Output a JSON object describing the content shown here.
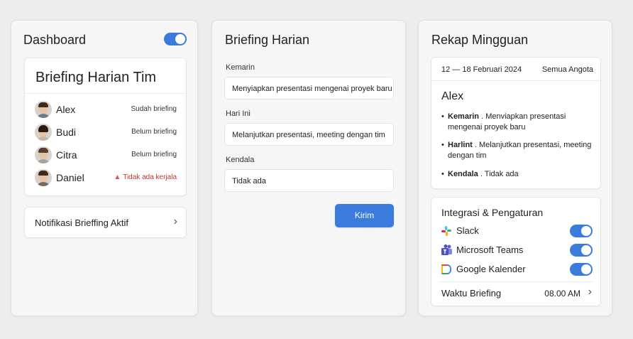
{
  "dashboard": {
    "title": "Dashboard",
    "toggle_on": true,
    "team_card_title": "Briefing Harian Tim",
    "members": [
      {
        "name": "Alex",
        "status": "Sudah briefing"
      },
      {
        "name": "Budi",
        "status": "Belum briefing"
      },
      {
        "name": "Citra",
        "status": "Belum briefing"
      },
      {
        "name": "Daniel",
        "status": "Tidak ada kerjala",
        "warning": true
      }
    ],
    "notification_label": "Notifikasi Brieffing Aktif"
  },
  "briefing": {
    "title": "Briefing Harian",
    "fields": [
      {
        "label": "Kemarin",
        "value": "Menyiapkan presentasi mengenai proyek baru"
      },
      {
        "label": "Hari Ini",
        "value": "Melanjutkan presentasi, meeting dengan tim"
      },
      {
        "label": "Kendala",
        "value": "Tidak ada"
      }
    ],
    "submit_label": "Kirim"
  },
  "recap": {
    "title": "Rekap Mingguan",
    "date_range": "12 — 18 Februari 2024",
    "scope": "Semua Angota",
    "person": "Alex",
    "items": [
      {
        "key": "Kemarin",
        "text": ". Menviapkan presentasi mengenai proyek baru"
      },
      {
        "key": "Harlint",
        "text": ". Melanjutkan presentasi, meeting dengan tim"
      },
      {
        "key": "Kendala",
        "text": ". Tidak ada"
      }
    ],
    "integrations_title": "Integrasi & Pengaturan",
    "integrations": [
      {
        "name": "Slack",
        "enabled": true
      },
      {
        "name": "Microsoft Teams",
        "enabled": true
      },
      {
        "name": "Google Kalender",
        "enabled": true
      }
    ],
    "briefing_time_label": "Waktu Briefing",
    "briefing_time_value": "08.00 AM"
  },
  "colors": {
    "accent": "#3a7bdc",
    "warning": "#c0392b"
  }
}
